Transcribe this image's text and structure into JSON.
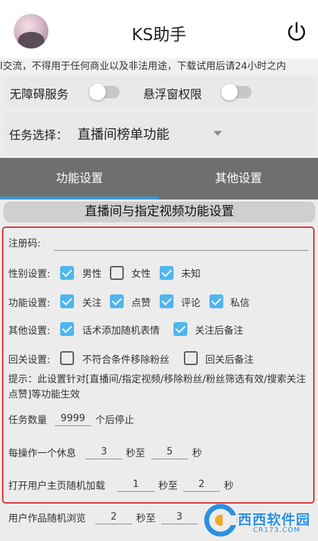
{
  "header": {
    "title": "KS助手",
    "avatar_icon": "avatar",
    "power_icon": "power-icon"
  },
  "notice_marquee": "l交流，不得用于任何商业以及非法用途，下载试用后请24小时之内",
  "toggles": {
    "accessibility_label": "无障碍服务",
    "accessibility_on": false,
    "floating_label": "悬浮窗权限",
    "floating_on": false
  },
  "task": {
    "label": "任务选择：",
    "selected": "直播间榜单功能"
  },
  "tabs": [
    {
      "label": "功能设置",
      "active": true
    },
    {
      "label": "其他设置",
      "active": false
    }
  ],
  "section_title": "直播间与指定视频功能设置",
  "form": {
    "reg_code_label": "注册码:",
    "reg_code_value": "",
    "gender": {
      "label": "性别设置:",
      "options": [
        {
          "label": "男性",
          "checked": true
        },
        {
          "label": "女性",
          "checked": false
        },
        {
          "label": "未知",
          "checked": true
        }
      ]
    },
    "features": {
      "label": "功能设置:",
      "options": [
        {
          "label": "关注",
          "checked": true
        },
        {
          "label": "点赞",
          "checked": true
        },
        {
          "label": "评论",
          "checked": true
        },
        {
          "label": "私信",
          "checked": true
        }
      ]
    },
    "other": {
      "label": "其他设置:",
      "options": [
        {
          "label": "话术添加随机表情",
          "checked": true
        },
        {
          "label": "关注后备注",
          "checked": true
        }
      ]
    },
    "follow_back": {
      "label": "回关设置:",
      "options": [
        {
          "label": "不符合条件移除粉丝",
          "checked": false
        },
        {
          "label": "回关后备注",
          "checked": false
        }
      ]
    },
    "hint": "提示：此设置针对[直播间/指定视频/移除粉丝/粉丝筛选有效/搜索关注点赞]等功能生效",
    "task_count": {
      "prefix": "任务数量",
      "value": "9999",
      "suffix": "个后停止"
    },
    "rest": {
      "prefix": "每操作一个休息",
      "min": "3",
      "mid": "秒至",
      "max": "5",
      "suffix": "秒"
    },
    "open_home": {
      "prefix": "打开用户主页随机加载",
      "min": "1",
      "mid": "秒至",
      "max": "2",
      "suffix": "秒"
    },
    "browse_works": {
      "prefix": "用户作品随机浏览",
      "min": "2",
      "mid": "秒至",
      "max": "3"
    }
  },
  "watermark": {
    "text": "西西软件园",
    "url": "CR173.COM"
  },
  "colors": {
    "accent": "#4fb6ee",
    "tab_bar": "#6f6f6f",
    "tab_indicator": "#2f9ae0",
    "highlight_border": "#e03030"
  }
}
